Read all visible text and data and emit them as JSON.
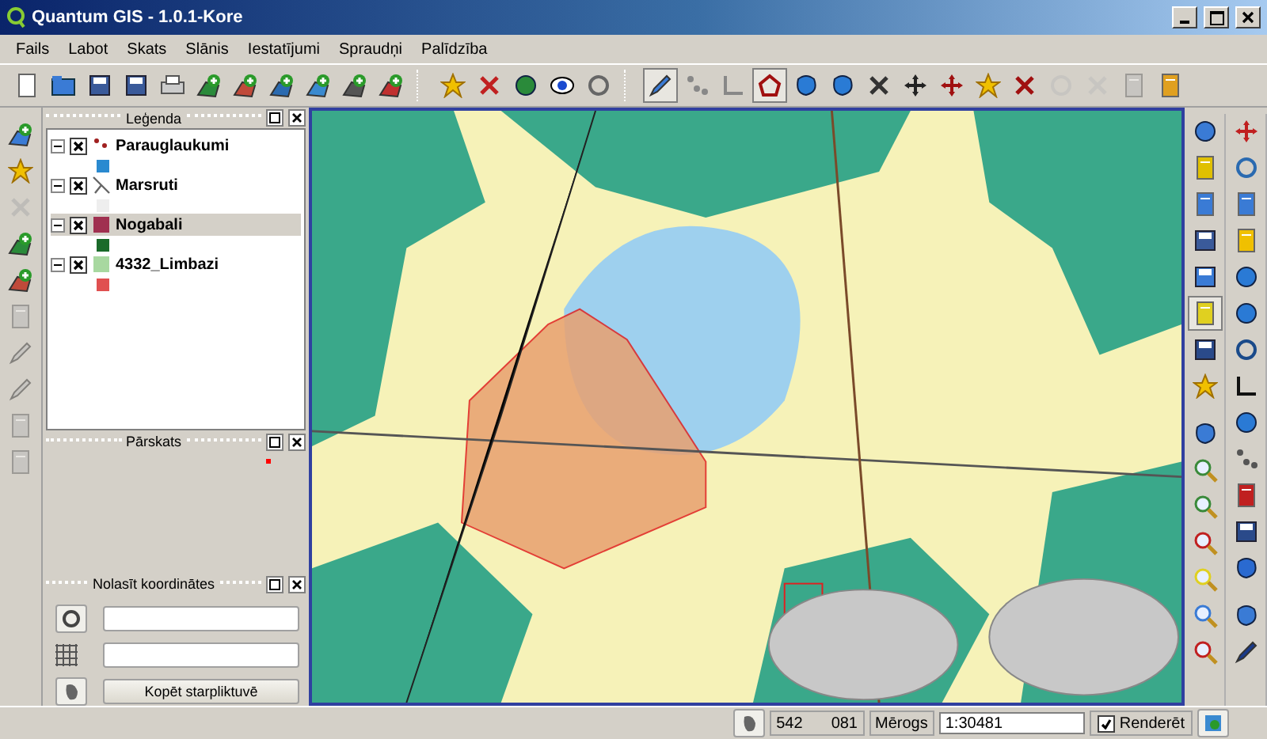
{
  "window": {
    "title": "Quantum GIS - 1.0.1-Kore"
  },
  "menu": [
    "Fails",
    "Labot",
    "Skats",
    "Slānis",
    "Iestatījumi",
    "Spraudņi",
    "Palīdzība"
  ],
  "top_toolbar": [
    {
      "selected": false
    },
    {
      "selected": false
    },
    {
      "selected": false
    },
    {
      "selected": false
    },
    {
      "selected": false
    },
    {
      "selected": false
    },
    {
      "selected": false
    },
    {
      "selected": false
    },
    {
      "selected": false
    },
    {
      "selected": false
    },
    {
      "selected": false
    },
    {
      "selected": false
    },
    {
      "selected": false
    },
    {
      "selected": false
    },
    {
      "selected": false
    },
    {
      "selected": false
    },
    {
      "selected": true
    },
    {
      "selected": false
    },
    {
      "selected": false
    },
    {
      "selected": true
    },
    {
      "selected": false
    },
    {
      "selected": false
    },
    {
      "selected": false
    },
    {
      "selected": false
    },
    {
      "selected": false
    },
    {
      "selected": false
    },
    {
      "selected": false
    },
    {
      "selected": false
    },
    {
      "selected": false
    },
    {
      "selected": false
    },
    {
      "selected": false
    }
  ],
  "right_toolbar": [
    {
      "selected": false
    },
    {
      "selected": false
    },
    {
      "selected": false
    },
    {
      "selected": false
    },
    {
      "selected": false
    },
    {
      "selected": true
    },
    {
      "selected": false
    },
    {
      "selected": false
    },
    {
      "selected": false
    },
    {
      "selected": false
    },
    {
      "selected": false
    },
    {
      "selected": false
    },
    {
      "selected": false
    },
    {
      "selected": false
    },
    {
      "selected": false
    }
  ],
  "legend": {
    "title": "Leģenda",
    "layers": [
      {
        "name": "Parauglaukumi",
        "checked": true,
        "expanded": true,
        "selected": false
      },
      {
        "name": "Marsruti",
        "checked": true,
        "expanded": true,
        "selected": false
      },
      {
        "name": "Nogabali",
        "checked": true,
        "expanded": true,
        "selected": true
      },
      {
        "name": "4332_Limbazi",
        "checked": true,
        "expanded": true,
        "selected": false
      }
    ]
  },
  "overview": {
    "title": "Pārskats"
  },
  "coordinates": {
    "title": "Nolasīt koordinātes",
    "copy_button": "Kopēt starpliktuvē"
  },
  "status_bar": {
    "coordinate_parts": [
      "542",
      "081"
    ],
    "scale_label": "Mērogs",
    "scale": "1:30481",
    "render_checked": true,
    "render_label": "Renderēt"
  }
}
